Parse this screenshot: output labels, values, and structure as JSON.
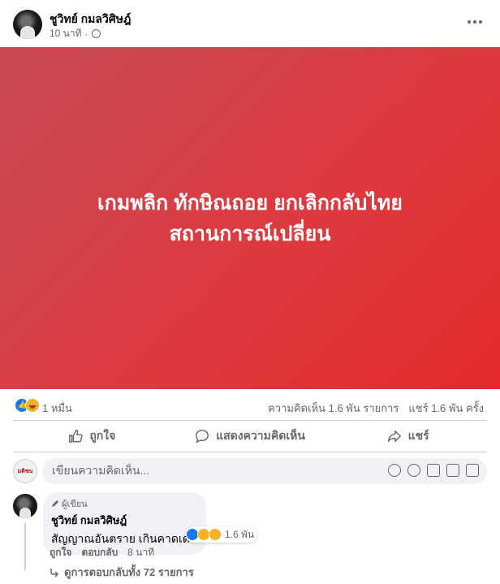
{
  "post": {
    "author": "ชูวิทย์ กมลวิศิษฎ์",
    "time": "10 นาที",
    "separator": "·"
  },
  "banner": {
    "line1": "เกมพลิก ทักษิณถอย ยกเลิกกลับไทย",
    "line2": "สถานการณ์เปลี่ยน",
    "gradient_from": "#c84a55",
    "gradient_to": "#e52a2d"
  },
  "stats": {
    "reactions": "1 หมื่น",
    "comments": "ความคิดเห็น 1.6 พัน รายการ",
    "shares": "แชร์ 1.6 พัน ครั้ง"
  },
  "actions": {
    "like": "ถูกใจ",
    "comment": "แสดงความคิดเห็น",
    "share": "แชร์"
  },
  "comment_box": {
    "placeholder": "เขียนความคิดเห็น...",
    "avatar_text": "มติชน"
  },
  "comment": {
    "role": "ผู้เขียน",
    "author": "ชูวิทย์ กมลวิศิษฎ์",
    "text": "สัญญาณอันตราย เกินคาดเดา",
    "reactions": "1.6 พัน",
    "like": "ถูกใจ",
    "reply": "ตอบกลับ",
    "time": "8 นาที",
    "view_replies": "ดูการตอบกลับทั้ง 72 รายการ"
  },
  "colors": {
    "like_blue": "#1877f2",
    "haha_yellow": "#f7b125",
    "secondary_text": "#65676b"
  },
  "icons": [
    "more-icon",
    "globe-icon",
    "like-icon",
    "comment-icon",
    "share-icon",
    "sticker-icon",
    "emoji-icon",
    "camera-icon",
    "gif-icon",
    "avatar-sticker-icon",
    "pencil-icon",
    "reply-arrow-icon"
  ]
}
